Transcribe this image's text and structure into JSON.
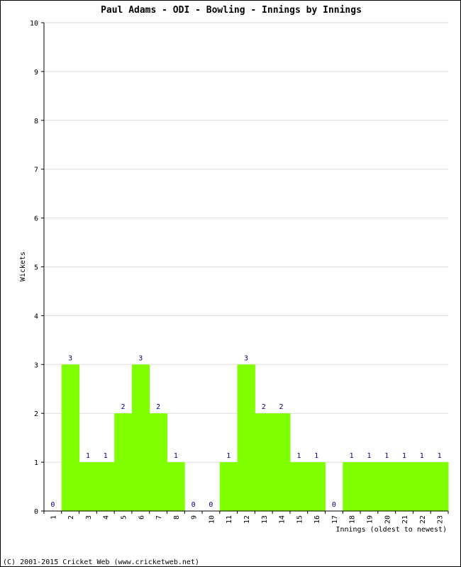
{
  "chart_data": {
    "type": "bar",
    "title": "Paul Adams - ODI - Bowling - Innings by Innings",
    "xlabel": "Innings (oldest to newest)",
    "ylabel": "Wickets",
    "ylim": [
      0,
      10
    ],
    "yticks": [
      0,
      1,
      2,
      3,
      4,
      5,
      6,
      7,
      8,
      9,
      10
    ],
    "grid": true,
    "categories": [
      "1",
      "2",
      "3",
      "4",
      "5",
      "6",
      "7",
      "8",
      "9",
      "10",
      "11",
      "12",
      "13",
      "14",
      "15",
      "16",
      "17",
      "18",
      "19",
      "20",
      "21",
      "22",
      "23"
    ],
    "values": [
      0,
      3,
      1,
      1,
      2,
      3,
      2,
      1,
      0,
      0,
      1,
      3,
      2,
      2,
      1,
      1,
      0,
      1,
      1,
      1,
      1,
      1,
      1
    ],
    "bar_color": "#80ff00",
    "label_color": "#000080"
  },
  "footer": "(C) 2001-2015 Cricket Web (www.cricketweb.net)"
}
